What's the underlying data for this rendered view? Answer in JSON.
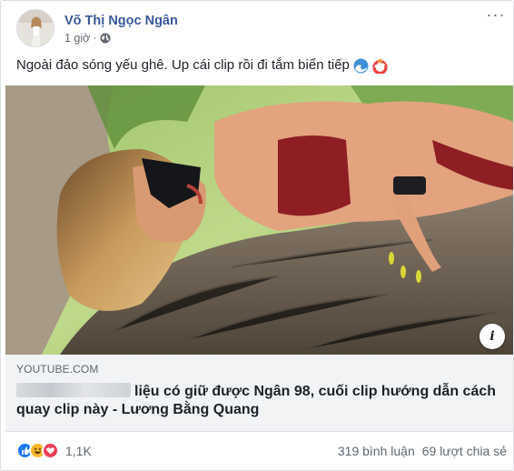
{
  "post": {
    "author": "Võ Thị Ngọc Ngân",
    "timestamp": "1 giờ",
    "privacy_icon": "globe-icon",
    "caption": "Ngoài đảo sóng yếu ghê. Up cái clip rồi đi tắm biển tiếp",
    "caption_emojis": [
      "wave-emoji",
      "swim-ring-emoji"
    ]
  },
  "link": {
    "domain": "YOUTUBE.COM",
    "title": "liệu có giữ được Ngân 98, cuối clip hướng dẫn cách quay clip này - Lương Bằng Quang",
    "info_icon": "i"
  },
  "footer": {
    "reactions": [
      "like-reaction",
      "haha-reaction",
      "love-reaction"
    ],
    "reaction_count": "1,1K",
    "comments": "319 bình luận",
    "shares": "69 lượt chia sẻ"
  },
  "colors": {
    "author_link": "#385898",
    "meta_text": "#616770",
    "link_bg": "#f2f3f5",
    "like_blue": "#1877f2",
    "love_red": "#f33e58",
    "haha_yellow": "#f7b928"
  }
}
